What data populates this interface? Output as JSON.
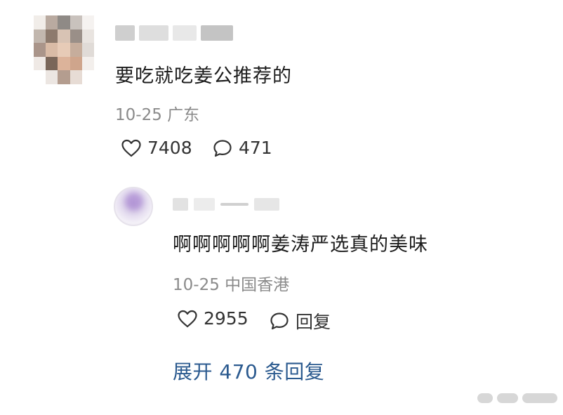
{
  "top_comment": {
    "text": "要吃就吃姜公推荐的",
    "date": "10-25",
    "location": "广东",
    "likes": "7408",
    "replies": "471"
  },
  "reply": {
    "text": "啊啊啊啊啊姜涛严选真的美味",
    "date": "10-25",
    "location": "中国香港",
    "likes": "2955",
    "reply_label": "回复"
  },
  "expand": {
    "label": "展开 470 条回复"
  },
  "icons": {
    "like": "heart-outline-icon",
    "comment": "speech-bubble-outline-icon"
  },
  "colors": {
    "link": "#2b5a8f",
    "meta": "#8a8a8a"
  }
}
